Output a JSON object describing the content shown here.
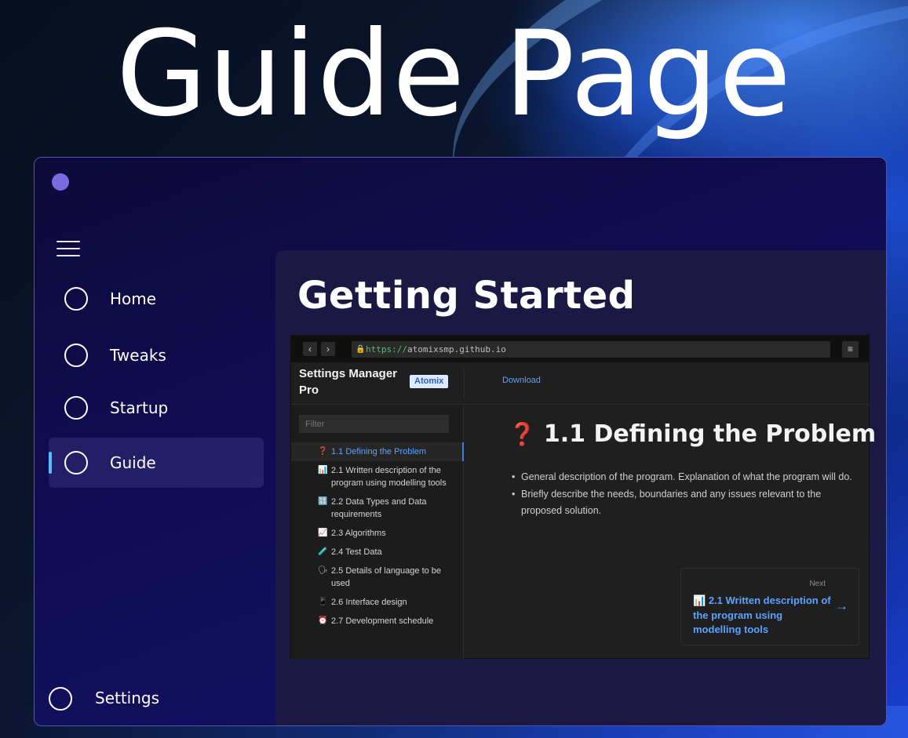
{
  "hero": {
    "title": "Guide Page"
  },
  "nav": {
    "items": [
      {
        "label": "Home"
      },
      {
        "label": "Tweaks"
      },
      {
        "label": "Startup"
      },
      {
        "label": "Guide"
      }
    ],
    "settings_label": "Settings"
  },
  "main": {
    "title": "Getting Started"
  },
  "browser": {
    "back": "‹",
    "forward": "›",
    "url_scheme": "https://",
    "url_host": "atomixsmp.github.io",
    "menu": "≡"
  },
  "site": {
    "title": "Settings Manager Pro",
    "badge": "Atomix",
    "download_link": "Download",
    "filter_placeholder": "Filter",
    "toc": [
      {
        "emoji": "❓",
        "label": "1.1 Defining the Problem"
      },
      {
        "emoji": "📊",
        "label": "2.1 Written description of the program using modelling tools"
      },
      {
        "emoji": "🔢",
        "label": "2.2 Data Types and Data requirements"
      },
      {
        "emoji": "📈",
        "label": "2.3 Algorithms"
      },
      {
        "emoji": "🧪",
        "label": "2.4 Test Data"
      },
      {
        "emoji": "🗣",
        "label": "2.5 Details of language to be used"
      },
      {
        "emoji": "📱",
        "label": "2.6 Interface design"
      },
      {
        "emoji": "⏰",
        "label": "2.7 Development schedule"
      }
    ],
    "doc": {
      "heading_emoji": "❓",
      "heading": "1.1 Defining the Problem",
      "bullets": [
        "General description of the program. Explanation of what the program will do.",
        "Briefly describe the needs, boundaries and any issues relevant to the proposed solution."
      ],
      "next_label": "Next",
      "next_emoji": "📊",
      "next_title": "2.1 Written description of the program using modelling tools",
      "next_arrow": "→"
    }
  },
  "colors": {
    "accent_indicator": "#5ab9ff",
    "window_dot": "#7a6ce0",
    "link_blue": "#5aa3ff",
    "badge_bg": "#dde9ff"
  }
}
